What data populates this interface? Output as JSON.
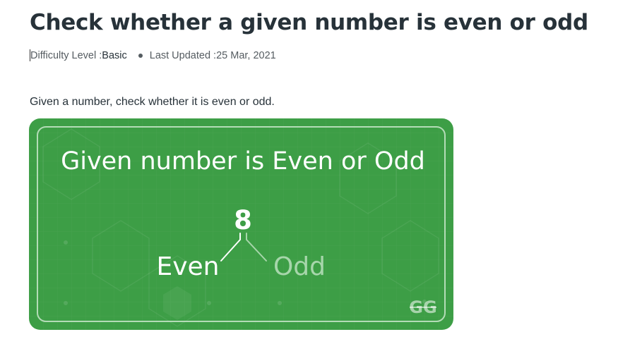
{
  "article": {
    "title": "Check whether a given number is even or odd",
    "difficulty_label": "Difficulty Level : ",
    "difficulty_value": "Basic",
    "updated_label": "Last Updated : ",
    "updated_value": "25 Mar, 2021",
    "intro": "Given a number, check whether it is even or odd."
  },
  "banner": {
    "heading": "Given number is Even or Odd",
    "number": "8",
    "even_label": "Even",
    "odd_label": "Odd",
    "logo_text": "GG",
    "logo_icon": "geeksforgeeks-logo-icon",
    "colors": {
      "background": "#3d9e46",
      "border": "#c9e6cb",
      "text": "#ffffff",
      "muted_text": "#a7d6ab"
    }
  }
}
